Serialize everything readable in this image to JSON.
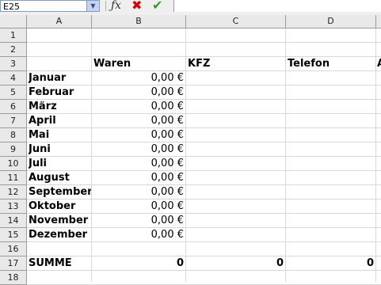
{
  "formula_bar": {
    "name_box": "E25",
    "fx_label": "ƒx",
    "cancel_glyph": "✖",
    "accept_glyph": "✔",
    "content": ""
  },
  "columns": [
    "A",
    "B",
    "C",
    "D"
  ],
  "rows": [
    "1",
    "2",
    "3",
    "4",
    "5",
    "6",
    "7",
    "8",
    "9",
    "10",
    "11",
    "12",
    "13",
    "14",
    "15",
    "16",
    "17",
    "18"
  ],
  "headers": {
    "b": "Waren",
    "c": "KFZ",
    "d": "Telefon",
    "e_partial": "A"
  },
  "months": [
    {
      "name": "Januar",
      "value": "0,00 €"
    },
    {
      "name": "Februar",
      "value": "0,00 €"
    },
    {
      "name": "März",
      "value": "0,00 €"
    },
    {
      "name": "April",
      "value": "0,00 €"
    },
    {
      "name": "Mai",
      "value": "0,00 €"
    },
    {
      "name": "Juni",
      "value": "0,00 €"
    },
    {
      "name": "Juli",
      "value": "0,00 €"
    },
    {
      "name": "August",
      "value": "0,00 €"
    },
    {
      "name": "September",
      "value": "0,00 €"
    },
    {
      "name": "Oktober",
      "value": "0,00 €"
    },
    {
      "name": "November",
      "value": "0,00 €"
    },
    {
      "name": "Dezember",
      "value": "0,00 €"
    }
  ],
  "summary": {
    "label": "SUMME",
    "b": "0",
    "c": "0",
    "d": "0"
  }
}
